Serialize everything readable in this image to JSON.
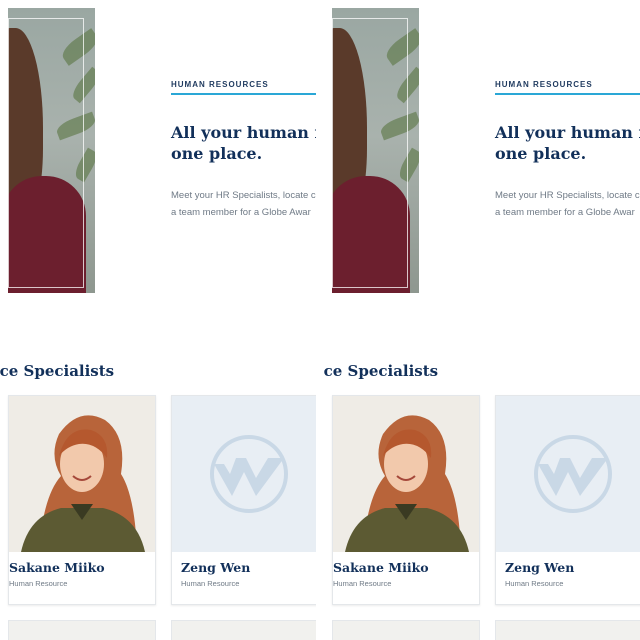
{
  "hero": {
    "eyebrow": "HUMAN RESOURCES",
    "title_line1": "All your human resc",
    "title_line2": "one place.",
    "desc_line1": "Meet your HR Specialists, locate c",
    "desc_line2": "a team member for a Globe Awar"
  },
  "section": {
    "title": "ırce Specialists"
  },
  "specialists": [
    {
      "name": "Sakane Miiko",
      "role": "Human Resource"
    },
    {
      "name": "Zeng Wen",
      "role": "Human Resource"
    }
  ],
  "colors": {
    "accent": "#2aa7d6",
    "heading": "#12305a",
    "body_text": "#6f7a86",
    "placeholder_logo": "#c9d8e6"
  },
  "icons": {
    "placeholder_logo": "company-logo-icon"
  }
}
